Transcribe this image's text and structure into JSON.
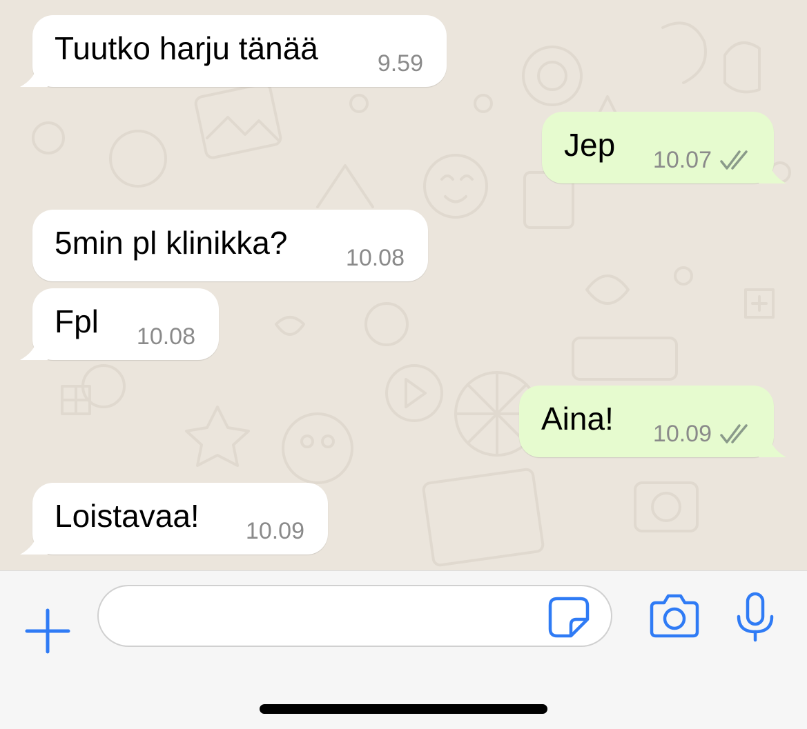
{
  "messages": [
    {
      "direction": "incoming",
      "text": "Tuutko harju tänää",
      "time": "9.59"
    },
    {
      "direction": "outgoing",
      "text": "Jep",
      "time": "10.07",
      "status": "read"
    },
    {
      "direction": "incoming",
      "text": "5min pl klinikka?",
      "time": "10.08"
    },
    {
      "direction": "incoming",
      "text": "Fpl",
      "time": "10.08"
    },
    {
      "direction": "outgoing",
      "text": "Aina!",
      "time": "10.09",
      "status": "read"
    },
    {
      "direction": "incoming",
      "text": "Loistavaa!",
      "time": "10.09"
    }
  ],
  "composer": {
    "input_value": "",
    "icons": {
      "attach": "plus-icon",
      "sticker": "sticker-icon",
      "camera": "camera-icon",
      "voice": "microphone-icon"
    }
  },
  "colors": {
    "chat_background": "#ebe5dc",
    "incoming_bubble": "#ffffff",
    "outgoing_bubble": "#e6fbcf",
    "accent": "#2f7bf5",
    "timestamp": "#8a8a8a"
  }
}
